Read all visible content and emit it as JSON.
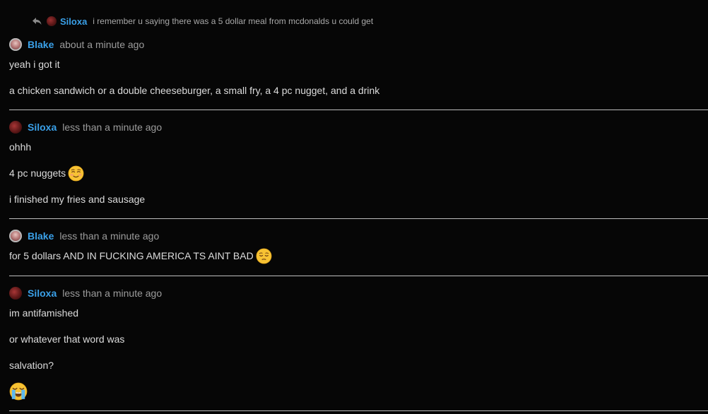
{
  "reply": {
    "author": "Siloxa",
    "text": "i remember u saying there was a 5 dollar meal from mcdonalds u could get"
  },
  "messages": [
    {
      "author": "Blake",
      "timestamp": "about a minute ago",
      "lines": [
        "yeah i got it",
        "a chicken sandwich or a double cheeseburger, a small fry, a 4 pc nugget, and a drink"
      ]
    },
    {
      "author": "Siloxa",
      "timestamp": "less than a minute ago",
      "lines": [
        "ohhh",
        "4 pc nuggets",
        "i finished my fries and sausage"
      ]
    },
    {
      "author": "Blake",
      "timestamp": "less than a minute ago",
      "lines": [
        "for 5 dollars AND IN FUCKING AMERICA TS AINT BAD"
      ]
    },
    {
      "author": "Siloxa",
      "timestamp": "less than a minute ago",
      "lines": [
        "im antifamished",
        "or whatever that word was",
        "salvation?"
      ]
    }
  ],
  "emojis": {
    "nuggets": "smiling-blush-emoji",
    "not_bad": "pensive-relieved-emoji",
    "salvation": "loudly-crying-emoji"
  },
  "colors": {
    "background": "#060606",
    "author": "#3aa0e8",
    "text": "#dcdcdc",
    "timestamp": "#9c9c9c",
    "divider": "#bdbdbd"
  }
}
